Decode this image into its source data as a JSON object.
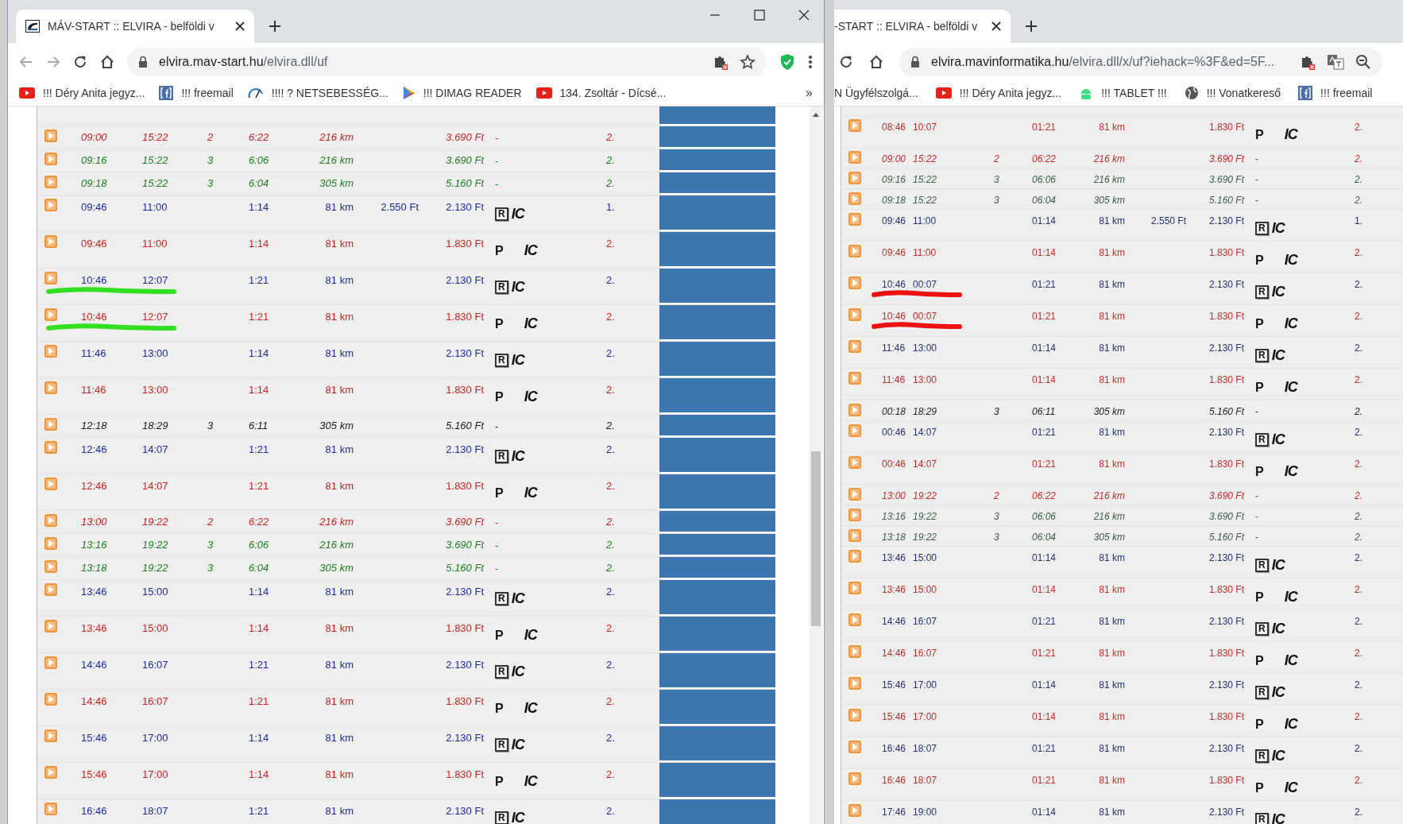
{
  "windows": [
    {
      "favicon": true,
      "window_controls": true,
      "nav_buttons": true,
      "side_column": true,
      "scrollbar": true,
      "tab": {
        "title": "MÁV-START :: ELVIRA - belföldi v"
      },
      "url": {
        "host": "elvira.mav-start.hu",
        "path": "/elvira.dll/uf"
      },
      "toolbar_icons": [
        {
          "kind": "extension"
        },
        {
          "kind": "star"
        },
        {
          "kind": "shield"
        },
        {
          "kind": "menu"
        }
      ],
      "bookmarks": [
        {
          "kind": "youtube",
          "label": "!!! Déry Anita jegyz..."
        },
        {
          "kind": "facebook",
          "label": "!!! freemail"
        },
        {
          "kind": "gauge",
          "label": "!!!! ? NETSEBESSÉG..."
        },
        {
          "kind": "play",
          "label": "!!! DIMAG READER"
        },
        {
          "kind": "youtube",
          "label": "134. Zsoltár - Dícsé..."
        }
      ],
      "more_bookmarks": "»",
      "rows": [
        {
          "kind": "dash",
          "color": "#cc1f1f",
          "dep": "09:00",
          "arr": "15:22",
          "changes": "2",
          "duration": "6:22",
          "distance": "216 km",
          "price": "3.690 Ft",
          "symbols": [
            "-"
          ],
          "class": "2."
        },
        {
          "kind": "dash",
          "color": "#1e7d1e",
          "dep": "09:16",
          "arr": "15:22",
          "changes": "3",
          "duration": "6:06",
          "distance": "216 km",
          "price": "3.690 Ft",
          "symbols": [
            "-"
          ],
          "class": "2."
        },
        {
          "kind": "dash",
          "color": "#1e7d1e",
          "dep": "09:18",
          "arr": "15:22",
          "changes": "3",
          "duration": "6:04",
          "distance": "305 km",
          "price": "5.160 Ft",
          "symbols": [
            "-"
          ],
          "class": "2."
        },
        {
          "kind": "reserved",
          "color": "#1c2a9c",
          "dep": "09:46",
          "arr": "11:00",
          "duration": "1:14",
          "distance": "81 km",
          "price_alt": "2.550 Ft",
          "price": "2.130 Ft",
          "symbols": [
            "R",
            "IC"
          ],
          "class": "1."
        },
        {
          "kind": "plain",
          "color": "#cc1f1f",
          "dep": "09:46",
          "arr": "11:00",
          "duration": "1:14",
          "distance": "81 km",
          "price": "1.830 Ft",
          "symbols": [
            "P",
            "IC"
          ],
          "class": "2."
        },
        {
          "kind": "reserved",
          "color": "#1c2a9c",
          "dep": "10:46",
          "arr": "12:07",
          "duration": "1:21",
          "distance": "81 km",
          "price": "2.130 Ft",
          "symbols": [
            "R",
            "IC"
          ],
          "class": "2.",
          "marker": {
            "color": "#33e01f"
          }
        },
        {
          "kind": "plain",
          "color": "#cc1f1f",
          "dep": "10:46",
          "arr": "12:07",
          "duration": "1:21",
          "distance": "81 km",
          "price": "1.830 Ft",
          "symbols": [
            "P",
            "IC"
          ],
          "class": "2.",
          "marker": {
            "color": "#33e01f"
          }
        },
        {
          "kind": "reserved",
          "color": "#1c2a9c",
          "dep": "11:46",
          "arr": "13:00",
          "duration": "1:14",
          "distance": "81 km",
          "price": "2.130 Ft",
          "symbols": [
            "R",
            "IC"
          ],
          "class": "2."
        },
        {
          "kind": "plain",
          "color": "#cc1f1f",
          "dep": "11:46",
          "arr": "13:00",
          "duration": "1:14",
          "distance": "81 km",
          "price": "1.830 Ft",
          "symbols": [
            "P",
            "IC"
          ],
          "class": "2."
        },
        {
          "kind": "dash",
          "color": "#1a1a1a",
          "dep": "12:18",
          "arr": "18:29",
          "changes": "3",
          "duration": "6:11",
          "distance": "305 km",
          "price": "5.160 Ft",
          "symbols": [
            "-"
          ],
          "class": "2."
        },
        {
          "kind": "reserved",
          "color": "#1c2a9c",
          "dep": "12:46",
          "arr": "14:07",
          "duration": "1:21",
          "distance": "81 km",
          "price": "2.130 Ft",
          "symbols": [
            "R",
            "IC"
          ],
          "class": "2."
        },
        {
          "kind": "plain",
          "color": "#cc1f1f",
          "dep": "12:46",
          "arr": "14:07",
          "duration": "1:21",
          "distance": "81 km",
          "price": "1.830 Ft",
          "symbols": [
            "P",
            "IC"
          ],
          "class": "2."
        },
        {
          "kind": "dash",
          "color": "#cc1f1f",
          "dep": "13:00",
          "arr": "19:22",
          "changes": "2",
          "duration": "6:22",
          "distance": "216 km",
          "price": "3.690 Ft",
          "symbols": [
            "-"
          ],
          "class": "2."
        },
        {
          "kind": "dash",
          "color": "#1e7d1e",
          "dep": "13:16",
          "arr": "19:22",
          "changes": "3",
          "duration": "6:06",
          "distance": "216 km",
          "price": "3.690 Ft",
          "symbols": [
            "-"
          ],
          "class": "2."
        },
        {
          "kind": "dash",
          "color": "#1e7d1e",
          "dep": "13:18",
          "arr": "19:22",
          "changes": "3",
          "duration": "6:04",
          "distance": "305 km",
          "price": "5.160 Ft",
          "symbols": [
            "-"
          ],
          "class": "2."
        },
        {
          "kind": "reserved",
          "color": "#1c2a9c",
          "dep": "13:46",
          "arr": "15:00",
          "duration": "1:14",
          "distance": "81 km",
          "price": "2.130 Ft",
          "symbols": [
            "R",
            "IC"
          ],
          "class": "2."
        },
        {
          "kind": "plain",
          "color": "#cc1f1f",
          "dep": "13:46",
          "arr": "15:00",
          "duration": "1:14",
          "distance": "81 km",
          "price": "1.830 Ft",
          "symbols": [
            "P",
            "IC"
          ],
          "class": "2."
        },
        {
          "kind": "reserved",
          "color": "#1c2a9c",
          "dep": "14:46",
          "arr": "16:07",
          "duration": "1:21",
          "distance": "81 km",
          "price": "2.130 Ft",
          "symbols": [
            "R",
            "IC"
          ],
          "class": "2."
        },
        {
          "kind": "plain",
          "color": "#cc1f1f",
          "dep": "14:46",
          "arr": "16:07",
          "duration": "1:21",
          "distance": "81 km",
          "price": "1.830 Ft",
          "symbols": [
            "P",
            "IC"
          ],
          "class": "2."
        },
        {
          "kind": "reserved",
          "color": "#1c2a9c",
          "dep": "15:46",
          "arr": "17:00",
          "duration": "1:14",
          "distance": "81 km",
          "price": "2.130 Ft",
          "symbols": [
            "R",
            "IC"
          ],
          "class": "2."
        },
        {
          "kind": "plain",
          "color": "#cc1f1f",
          "dep": "15:46",
          "arr": "17:00",
          "duration": "1:14",
          "distance": "81 km",
          "price": "1.830 Ft",
          "symbols": [
            "P",
            "IC"
          ],
          "class": "2."
        },
        {
          "kind": "reserved",
          "color": "#1c2a9c",
          "dep": "16:46",
          "arr": "18:07",
          "duration": "1:21",
          "distance": "81 km",
          "price": "2.130 Ft",
          "symbols": [
            "R",
            "IC"
          ],
          "class": "2."
        }
      ]
    },
    {
      "favicon": false,
      "window_controls": false,
      "nav_buttons": false,
      "side_column": false,
      "scrollbar": false,
      "tab": {
        "title": "-START :: ELVIRA - belföldi v"
      },
      "url": {
        "host": "elvira.mavinformatika.hu",
        "path": "/elvira.dll/x/uf?iehack=%3F&ed=5F..."
      },
      "toolbar_icons": [
        {
          "kind": "extension"
        },
        {
          "kind": "translate"
        },
        {
          "kind": "zoom"
        }
      ],
      "bookmarks": [
        {
          "kind": "none",
          "label": "N Ügyfélszolgá..."
        },
        {
          "kind": "youtube",
          "label": "!!! Déry Anita jegyz..."
        },
        {
          "kind": "android",
          "label": "!!! TABLET !!!"
        },
        {
          "kind": "globe",
          "label": "!!! Vonatkereső"
        },
        {
          "kind": "facebook",
          "label": "!!! freemail"
        }
      ],
      "rows": [
        {
          "kind": "plain",
          "color": "#c42b2b",
          "dep": "08:46",
          "arr": "10:07",
          "duration": "01:21",
          "distance": "81 km",
          "price": "1.830 Ft",
          "symbols": [
            "P",
            "IC"
          ],
          "class": "2."
        },
        {
          "kind": "dash",
          "color": "#c42b2b",
          "dep": "09:00",
          "arr": "15:22",
          "changes": "2",
          "duration": "06:22",
          "distance": "216 km",
          "price": "3.690 Ft",
          "symbols": [
            "-"
          ],
          "class": "2."
        },
        {
          "kind": "dash",
          "color": "#3d5e46",
          "dep": "09:16",
          "arr": "15:22",
          "changes": "3",
          "duration": "06:06",
          "distance": "216 km",
          "price": "3.690 Ft",
          "symbols": [
            "-"
          ],
          "class": "2."
        },
        {
          "kind": "dash",
          "color": "#3d5e46",
          "dep": "09:18",
          "arr": "15:22",
          "changes": "3",
          "duration": "06:04",
          "distance": "305 km",
          "price": "5.160 Ft",
          "symbols": [
            "-"
          ],
          "class": "2."
        },
        {
          "kind": "reserved",
          "color": "#233070",
          "dep": "09:46",
          "arr": "11:00",
          "duration": "01:14",
          "distance": "81 km",
          "price_alt": "2.550 Ft",
          "price": "2.130 Ft",
          "symbols": [
            "R",
            "IC"
          ],
          "class": "1."
        },
        {
          "kind": "plain",
          "color": "#c42b2b",
          "dep": "09:46",
          "arr": "11:00",
          "duration": "01:14",
          "distance": "81 km",
          "price": "1.830 Ft",
          "symbols": [
            "P",
            "IC"
          ],
          "class": "2."
        },
        {
          "kind": "reserved",
          "color": "#233070",
          "dep": "10:46",
          "arr": "00:07",
          "duration": "01:21",
          "distance": "81 km",
          "price": "2.130 Ft",
          "symbols": [
            "R",
            "IC"
          ],
          "class": "2.",
          "marker": {
            "color": "#ee1111"
          }
        },
        {
          "kind": "plain",
          "color": "#c42b2b",
          "dep": "10:46",
          "arr": "00:07",
          "duration": "01:21",
          "distance": "81 km",
          "price": "1.830 Ft",
          "symbols": [
            "P",
            "IC"
          ],
          "class": "2.",
          "marker": {
            "color": "#ee1111"
          }
        },
        {
          "kind": "reserved",
          "color": "#233070",
          "dep": "11:46",
          "arr": "13:00",
          "duration": "01:14",
          "distance": "81 km",
          "price": "2.130 Ft",
          "symbols": [
            "R",
            "IC"
          ],
          "class": "2."
        },
        {
          "kind": "plain",
          "color": "#c42b2b",
          "dep": "11:46",
          "arr": "13:00",
          "duration": "01:14",
          "distance": "81 km",
          "price": "1.830 Ft",
          "symbols": [
            "P",
            "IC"
          ],
          "class": "2."
        },
        {
          "kind": "dash",
          "color": "#222222",
          "dep": "00:18",
          "arr": "18:29",
          "changes": "3",
          "duration": "06:11",
          "distance": "305 km",
          "price": "5.160 Ft",
          "symbols": [
            "-"
          ],
          "class": "2."
        },
        {
          "kind": "reserved",
          "color": "#233070",
          "dep": "00:46",
          "arr": "14:07",
          "duration": "01:21",
          "distance": "81 km",
          "price": "2.130 Ft",
          "symbols": [
            "R",
            "IC"
          ],
          "class": "2."
        },
        {
          "kind": "plain",
          "color": "#c42b2b",
          "dep": "00:46",
          "arr": "14:07",
          "duration": "01:21",
          "distance": "81 km",
          "price": "1.830 Ft",
          "symbols": [
            "P",
            "IC"
          ],
          "class": "2."
        },
        {
          "kind": "dash",
          "color": "#c42b2b",
          "dep": "13:00",
          "arr": "19:22",
          "changes": "2",
          "duration": "06:22",
          "distance": "216 km",
          "price": "3.690 Ft",
          "symbols": [
            "-"
          ],
          "class": "2."
        },
        {
          "kind": "dash",
          "color": "#3d5e46",
          "dep": "13:16",
          "arr": "19:22",
          "changes": "3",
          "duration": "06:06",
          "distance": "216 km",
          "price": "3.690 Ft",
          "symbols": [
            "-"
          ],
          "class": "2."
        },
        {
          "kind": "dash",
          "color": "#3d5e46",
          "dep": "13:18",
          "arr": "19:22",
          "changes": "3",
          "duration": "06:04",
          "distance": "305 km",
          "price": "5.160 Ft",
          "symbols": [
            "-"
          ],
          "class": "2."
        },
        {
          "kind": "reserved",
          "color": "#233070",
          "dep": "13:46",
          "arr": "15:00",
          "duration": "01:14",
          "distance": "81 km",
          "price": "2.130 Ft",
          "symbols": [
            "R",
            "IC"
          ],
          "class": "2."
        },
        {
          "kind": "plain",
          "color": "#c42b2b",
          "dep": "13:46",
          "arr": "15:00",
          "duration": "01:14",
          "distance": "81 km",
          "price": "1.830 Ft",
          "symbols": [
            "P",
            "IC"
          ],
          "class": "2."
        },
        {
          "kind": "reserved",
          "color": "#233070",
          "dep": "14:46",
          "arr": "16:07",
          "duration": "01:21",
          "distance": "81 km",
          "price": "2.130 Ft",
          "symbols": [
            "R",
            "IC"
          ],
          "class": "2."
        },
        {
          "kind": "plain",
          "color": "#c42b2b",
          "dep": "14:46",
          "arr": "16:07",
          "duration": "01:21",
          "distance": "81 km",
          "price": "1.830 Ft",
          "symbols": [
            "P",
            "IC"
          ],
          "class": "2."
        },
        {
          "kind": "reserved",
          "color": "#233070",
          "dep": "15:46",
          "arr": "17:00",
          "duration": "01:14",
          "distance": "81 km",
          "price": "2.130 Ft",
          "symbols": [
            "R",
            "IC"
          ],
          "class": "2."
        },
        {
          "kind": "plain",
          "color": "#c42b2b",
          "dep": "15:46",
          "arr": "17:00",
          "duration": "01:14",
          "distance": "81 km",
          "price": "1.830 Ft",
          "symbols": [
            "P",
            "IC"
          ],
          "class": "2."
        },
        {
          "kind": "reserved",
          "color": "#233070",
          "dep": "16:46",
          "arr": "18:07",
          "duration": "01:21",
          "distance": "81 km",
          "price": "2.130 Ft",
          "symbols": [
            "R",
            "IC"
          ],
          "class": "2."
        },
        {
          "kind": "plain",
          "color": "#c42b2b",
          "dep": "16:46",
          "arr": "18:07",
          "duration": "01:21",
          "distance": "81 km",
          "price": "1.830 Ft",
          "symbols": [
            "P",
            "IC"
          ],
          "class": "2."
        },
        {
          "kind": "reserved",
          "color": "#233070",
          "dep": "17:46",
          "arr": "19:00",
          "duration": "01:14",
          "distance": "81 km",
          "price": "2.130 Ft",
          "symbols": [
            "R",
            "IC"
          ],
          "class": "2."
        }
      ]
    }
  ]
}
